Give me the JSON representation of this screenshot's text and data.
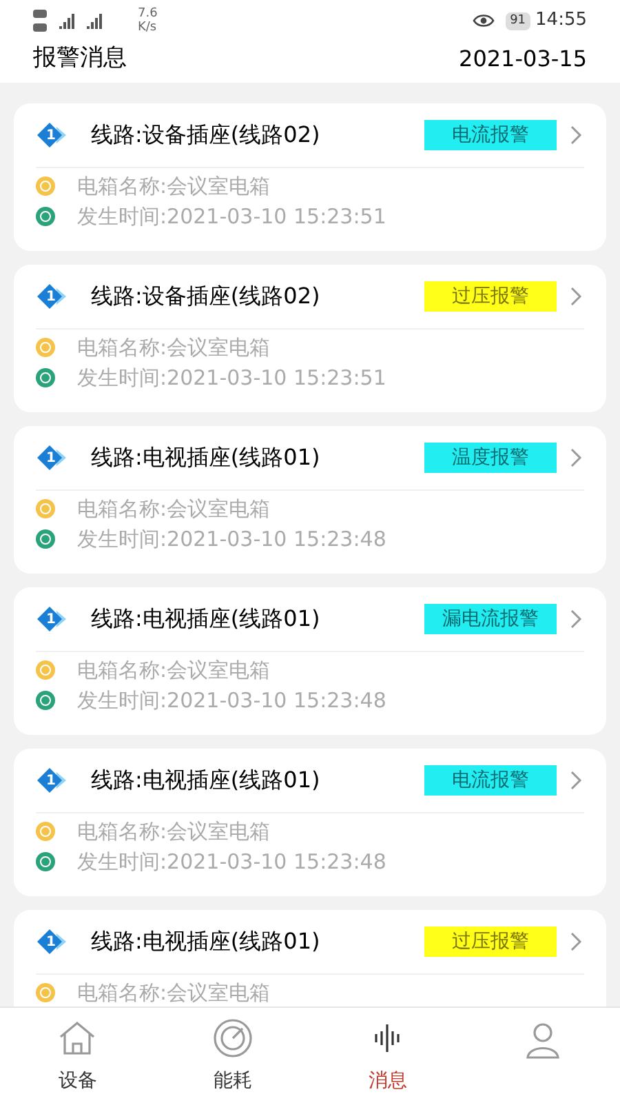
{
  "status_bar": {
    "speed": "7.6",
    "speed_unit": "K/s",
    "battery": "91",
    "time": "14:55"
  },
  "header": {
    "title": "报警消息",
    "date": "2021-03-15"
  },
  "alarms": [
    {
      "index": "1",
      "line": "线路:设备插座(线路02)",
      "badge": "电流报警",
      "color": "#22eef2",
      "box": "电箱名称:会议室电箱",
      "time": "发生时间:2021-03-10 15:23:51"
    },
    {
      "index": "1",
      "line": "线路:设备插座(线路02)",
      "badge": "过压报警",
      "color": "#ffff1a",
      "box": "电箱名称:会议室电箱",
      "time": "发生时间:2021-03-10 15:23:51"
    },
    {
      "index": "1",
      "line": "线路:电视插座(线路01)",
      "badge": "温度报警",
      "color": "#22eef2",
      "box": "电箱名称:会议室电箱",
      "time": "发生时间:2021-03-10 15:23:48"
    },
    {
      "index": "1",
      "line": "线路:电视插座(线路01)",
      "badge": "漏电流报警",
      "color": "#22eef2",
      "box": "电箱名称:会议室电箱",
      "time": "发生时间:2021-03-10 15:23:48"
    },
    {
      "index": "1",
      "line": "线路:电视插座(线路01)",
      "badge": "电流报警",
      "color": "#22eef2",
      "box": "电箱名称:会议室电箱",
      "time": "发生时间:2021-03-10 15:23:48"
    },
    {
      "index": "1",
      "line": "线路:电视插座(线路01)",
      "badge": "过压报警",
      "color": "#ffff1a",
      "box": "电箱名称:会议室电箱"
    }
  ],
  "nav": [
    {
      "kind": "home",
      "label": "设备",
      "selected": false
    },
    {
      "kind": "gauge",
      "label": "能耗",
      "selected": false
    },
    {
      "kind": "wave",
      "label": "消息",
      "selected": true
    },
    {
      "kind": "person",
      "selected": false
    }
  ]
}
